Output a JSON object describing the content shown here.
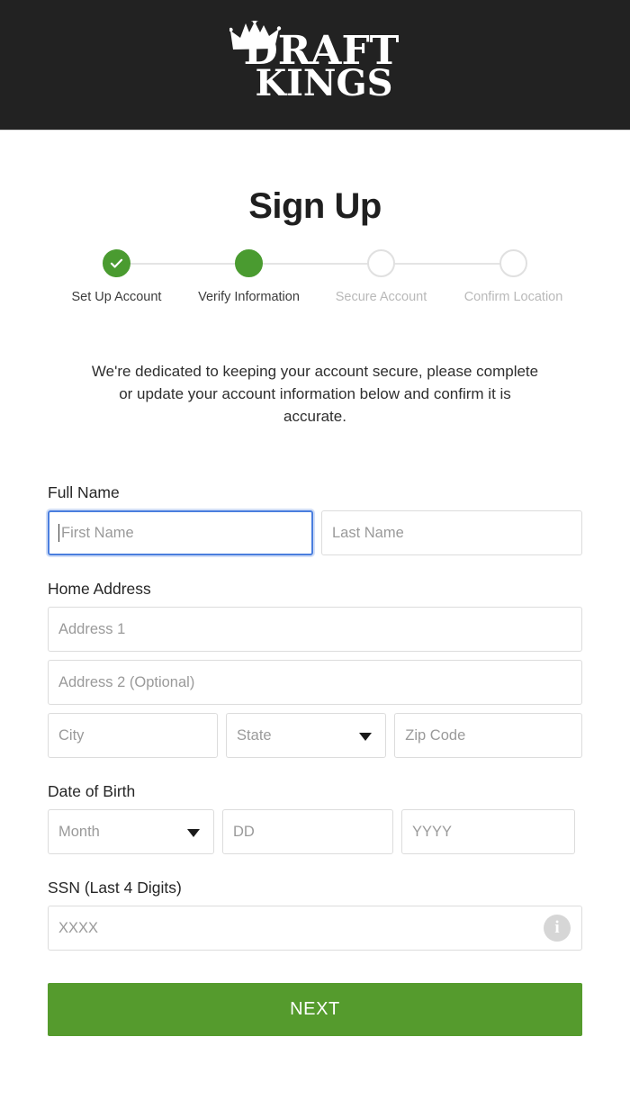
{
  "header": {
    "logo_line1": "DRAFT",
    "logo_line2": "KINGS",
    "logo_icon": "crown-icon",
    "background_color": "#222222"
  },
  "page_title": "Sign Up",
  "stepper": {
    "steps": [
      {
        "label": "Set Up Account",
        "state": "done"
      },
      {
        "label": "Verify Information",
        "state": "active"
      },
      {
        "label": "Secure Account",
        "state": "todo"
      },
      {
        "label": "Confirm Location",
        "state": "todo"
      }
    ],
    "active_color": "#4a9b30",
    "inactive_color": "#e0e0e0"
  },
  "intro_text": "We're dedicated to keeping your account secure, please complete or update your account information below and confirm it is accurate.",
  "form": {
    "full_name": {
      "label": "Full Name",
      "first_name_placeholder": "First Name",
      "first_name_value": "",
      "last_name_placeholder": "Last Name",
      "last_name_value": ""
    },
    "home_address": {
      "label": "Home Address",
      "address1_placeholder": "Address 1",
      "address1_value": "",
      "address2_placeholder": "Address 2 (Optional)",
      "address2_value": "",
      "city_placeholder": "City",
      "city_value": "",
      "state_placeholder": "State",
      "state_value": "",
      "zip_placeholder": "Zip Code",
      "zip_value": ""
    },
    "date_of_birth": {
      "label": "Date of Birth",
      "month_placeholder": "Month",
      "month_value": "",
      "day_placeholder": "DD",
      "day_value": "",
      "year_placeholder": "YYYY",
      "year_value": ""
    },
    "ssn": {
      "label": "SSN (Last 4 Digits)",
      "placeholder": "XXXX",
      "value": "",
      "info_icon": "info-icon"
    },
    "submit_label": "NEXT",
    "submit_color": "#559b2d",
    "focus_color": "#4a7ede"
  }
}
